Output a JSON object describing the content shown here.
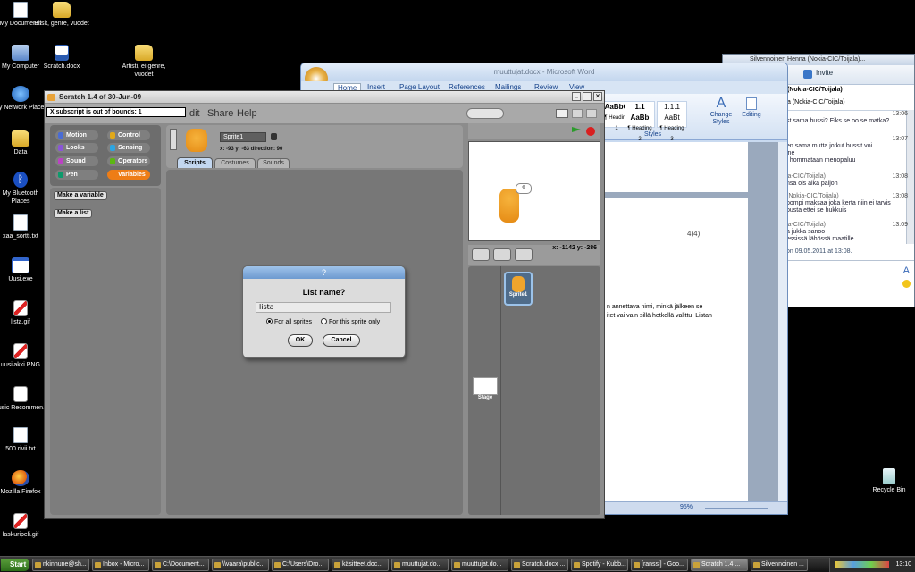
{
  "desktop": {
    "icons": [
      {
        "label": "My Documents",
        "icon": "documents-icon"
      },
      {
        "label": "My Computer",
        "icon": "computer-icon"
      },
      {
        "label": "My Network Places",
        "icon": "network-icon"
      },
      {
        "label": "Data",
        "icon": "folder-icon"
      },
      {
        "label": "My Bluetooth Places",
        "icon": "bluetooth-icon"
      },
      {
        "label": "xaa_sortti.txt",
        "icon": "text-file-icon"
      },
      {
        "label": "Uusi.exe",
        "icon": "exe-icon"
      },
      {
        "label": "lista.gif",
        "icon": "image-icon"
      },
      {
        "label": "uusilakki.PNG",
        "icon": "image-icon"
      },
      {
        "label": "Music Recommen...",
        "icon": "music-file-icon"
      },
      {
        "label": "500 rivii.txt",
        "icon": "text-file-icon"
      },
      {
        "label": "Mozilla Firefox",
        "icon": "firefox-icon"
      },
      {
        "label": "laskuripeli.gif",
        "icon": "image-icon"
      },
      {
        "label": "Biisit, genre, vuodet",
        "icon": "folder-icon"
      },
      {
        "label": "Scratch.docx",
        "icon": "word-doc-icon"
      },
      {
        "label": "Artisti, ei genre, vuodet",
        "icon": "folder-icon"
      },
      {
        "label": "Recycle Bin",
        "icon": "recycle-bin-icon"
      }
    ]
  },
  "word": {
    "title": "muuttujat.docx - Microsoft Word",
    "tabs": [
      "Home",
      "Insert",
      "Page Layout",
      "References",
      "Mailings",
      "Review",
      "View"
    ],
    "styles": [
      {
        "preview": "AaBbC",
        "name": "¶ Heading 1"
      },
      {
        "preview": "1.1 AaBb",
        "name": "¶ Heading 2"
      },
      {
        "preview": "1.1.1 AaBt",
        "name": "¶ Heading 3"
      }
    ],
    "change_styles": "Change Styles",
    "editing": "Editing",
    "group_styles": "Styles",
    "page_number": "4(4)",
    "doc_text": [
      "n annettava nimi, minkä jälkeen se",
      "itet vai vain sillä hetkellä valittu. Listan"
    ],
    "zoom": "95%"
  },
  "communicator": {
    "title": "Silvennoinen Henna (Nokia-CIC/Toijala)...",
    "invite": "Invite",
    "contact": "(Nokia-CIC/Toijala)",
    "contact2": "a (Nokia-CIC/Toijala)",
    "messages": [
      {
        "name": "(Nokia-CIC/Toijala)",
        "time": "13:06",
        "lines": [
          "st sama bussi? Eiks se oo se matka?"
        ]
      },
      {
        "name": "",
        "time": "13:07",
        "lines": [
          "en sama mutta jotkut bussit voi",
          "jne",
          "t hommataan menopaluu"
        ]
      },
      {
        "name": "ia-CIC/Toijala)",
        "time": "13:08",
        "lines": [
          "nsa ois aika paljon"
        ]
      },
      {
        "name": "(Nokia-CIC/Toijala)",
        "time": "13:08",
        "lines": [
          "pompi maksaa joka kerta niin ei tarvis",
          "pusta ettei se hukkuis"
        ]
      },
      {
        "name": "ia-CIC/Toijala)",
        "time": "13:09",
        "lines": [
          "a jukka sanoo",
          "essissä lähössä maatille"
        ]
      }
    ],
    "footer": "on 09.05.2011 at 13:08."
  },
  "scratch": {
    "title": "Scratch 1.4 of 30-Jun-09",
    "error": "subscript is out of bounds: 1",
    "menu": [
      "dit",
      "Share",
      "Help"
    ],
    "categories": [
      {
        "label": "Motion",
        "color": "#4a6cd4"
      },
      {
        "label": "Control",
        "color": "#e1a91a"
      },
      {
        "label": "Looks",
        "color": "#8a55d7"
      },
      {
        "label": "Sensing",
        "color": "#2ca5e2"
      },
      {
        "label": "Sound",
        "color": "#bb42c3"
      },
      {
        "label": "Operators",
        "color": "#5cb712"
      },
      {
        "label": "Pen",
        "color": "#0e9a6c"
      },
      {
        "label": "Variables",
        "color": "#ee7d16"
      }
    ],
    "make_variable": "Make a variable",
    "make_list": "Make a list",
    "sprite_name": "Sprite1",
    "sprite_info": "x: -93   y: -63   direction: 90",
    "tabs": [
      "Scripts",
      "Costumes",
      "Sounds"
    ],
    "stage_coords": "x: -1142  y: -286",
    "sprite_label": "Sprite1",
    "stage_label": "Stage",
    "speech": "9"
  },
  "dialog": {
    "title": "?",
    "prompt": "List name?",
    "value": "lista",
    "option_all": "For all sprites",
    "option_this": "For this sprite only",
    "ok": "OK",
    "cancel": "Cancel"
  },
  "taskbar": {
    "start": "Start",
    "items": [
      "nkinnune@sh...",
      "Inbox - Micro...",
      "C:\\Document...",
      "\\\\vaara\\public...",
      "C:\\Users\\Dro...",
      "käsitteet.doc...",
      "muuttujat.do...",
      "muuttujat.do...",
      "Scratch.docx ...",
      "Spotify - Kubb...",
      "[ranssi] - Goo...",
      "Scratch 1.4 ...",
      "Silvennoinen ..."
    ],
    "active_index": 11,
    "clock": "13:10"
  }
}
